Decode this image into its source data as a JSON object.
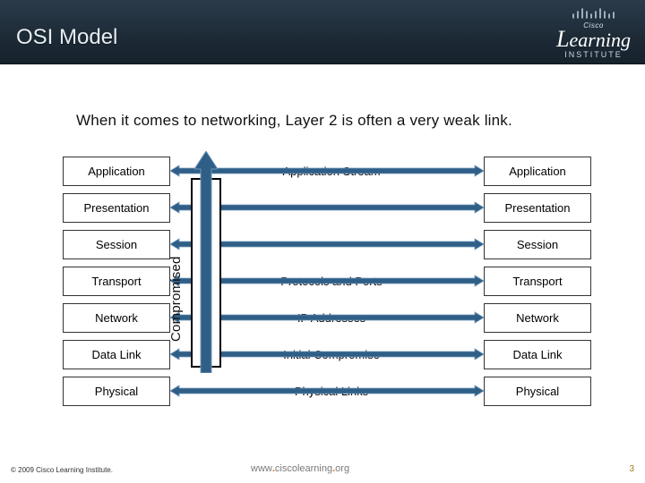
{
  "header": {
    "title": "OSI Model",
    "brand_small": "Cisco",
    "brand": "Learning",
    "brand_sub": "INSTITUTE"
  },
  "subtitle": "When it comes to networking, Layer 2 is often a very weak link.",
  "layers_left": [
    "Application",
    "Presentation",
    "Session",
    "Transport",
    "Network",
    "Data Link",
    "Physical"
  ],
  "layers_right": [
    "Application",
    "Presentation",
    "Session",
    "Transport",
    "Network",
    "Data Link",
    "Physical"
  ],
  "middle": [
    "Application Stream",
    "",
    "",
    "Protocols and Ports",
    "IP Addresses",
    "Initial Compromise",
    "Physical Links"
  ],
  "compromised_label": "Compromised",
  "footer": {
    "copyright": "© 2009 Cisco Learning Institute.",
    "url_pre": "www",
    "url_mid": "ciscolearning",
    "url_post": "org",
    "page": "3"
  },
  "colors": {
    "arrow_fill": "#2f5e86",
    "arrow_stroke": "#7aa3c4"
  }
}
